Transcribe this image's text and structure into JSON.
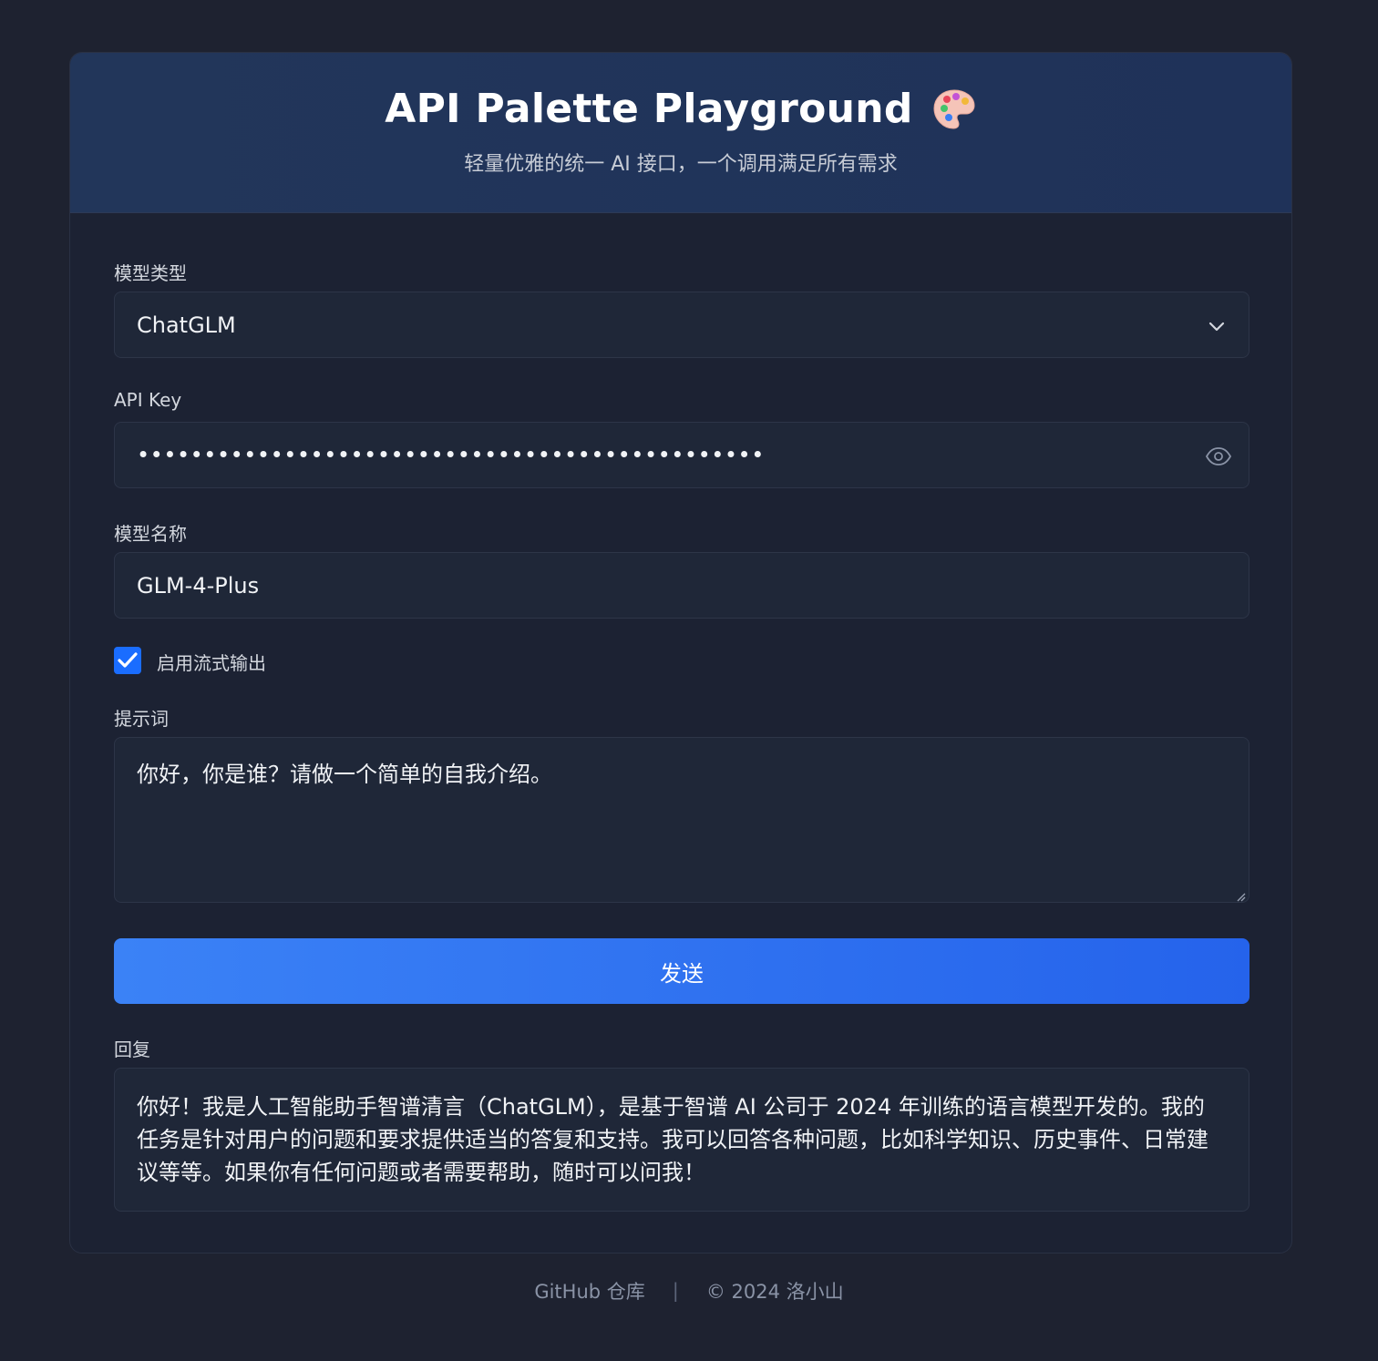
{
  "header": {
    "title": "API Palette Playground",
    "title_icon": "palette-icon",
    "subtitle": "轻量优雅的统一 AI 接口，一个调用满足所有需求"
  },
  "form": {
    "model_type_label": "模型类型",
    "model_type_value": "ChatGLM",
    "api_key_label": "API Key",
    "api_key_masked": "•••••••••••••••••••••••••••••••••••••••••••••••",
    "model_name_label": "模型名称",
    "model_name_value": "GLM-4-Plus",
    "stream_label": "启用流式输出",
    "stream_checked": true,
    "prompt_label": "提示词",
    "prompt_value": "你好，你是谁？请做一个简单的自我介绍。",
    "send_label": "发送",
    "reply_label": "回复",
    "reply_text": "你好！我是人工智能助手智谱清言（ChatGLM），是基于智谱 AI 公司于 2024 年训练的语言模型开发的。我的任务是针对用户的问题和要求提供适当的答复和支持。我可以回答各种问题，比如科学知识、历史事件、日常建议等等。如果你有任何问题或者需要帮助，随时可以问我！"
  },
  "footer": {
    "github_link": "GitHub 仓库",
    "separator": "|",
    "copyright": "© 2024 洛小山"
  },
  "colors": {
    "background": "#1e2230",
    "card": "#1c2233",
    "header": "#22365a",
    "field": "#1f2738",
    "accent": "#3b82f6",
    "checkbox": "#1a6dff"
  }
}
